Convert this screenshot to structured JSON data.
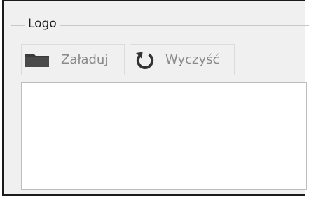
{
  "group": {
    "title": "Logo"
  },
  "toolbar": {
    "load_label": "Załaduj",
    "clear_label": "Wyczyść"
  },
  "icons": {
    "load": "folder-icon",
    "clear": "refresh-icon"
  },
  "colors": {
    "panel_background": "#f0f0f0",
    "disabled_text": "#8a8a8a",
    "icon_dark": "#3a3a3a",
    "preview_background": "#ffffff"
  }
}
